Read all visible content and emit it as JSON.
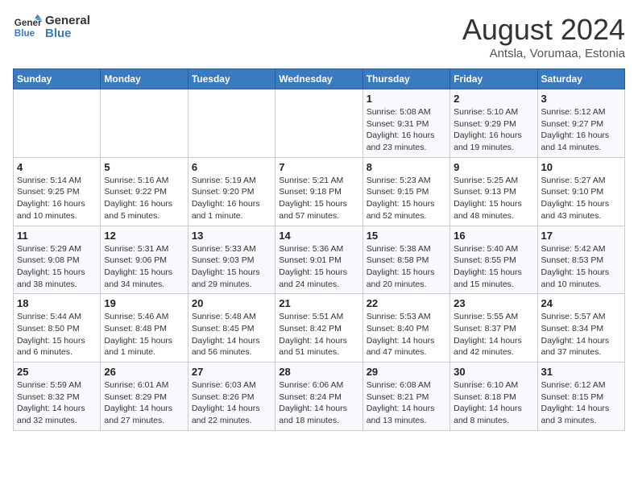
{
  "header": {
    "logo_line1": "General",
    "logo_line2": "Blue",
    "month": "August 2024",
    "location": "Antsla, Vorumaa, Estonia"
  },
  "weekdays": [
    "Sunday",
    "Monday",
    "Tuesday",
    "Wednesday",
    "Thursday",
    "Friday",
    "Saturday"
  ],
  "weeks": [
    [
      {
        "day": "",
        "info": ""
      },
      {
        "day": "",
        "info": ""
      },
      {
        "day": "",
        "info": ""
      },
      {
        "day": "",
        "info": ""
      },
      {
        "day": "1",
        "info": "Sunrise: 5:08 AM\nSunset: 9:31 PM\nDaylight: 16 hours and 23 minutes."
      },
      {
        "day": "2",
        "info": "Sunrise: 5:10 AM\nSunset: 9:29 PM\nDaylight: 16 hours and 19 minutes."
      },
      {
        "day": "3",
        "info": "Sunrise: 5:12 AM\nSunset: 9:27 PM\nDaylight: 16 hours and 14 minutes."
      }
    ],
    [
      {
        "day": "4",
        "info": "Sunrise: 5:14 AM\nSunset: 9:25 PM\nDaylight: 16 hours and 10 minutes."
      },
      {
        "day": "5",
        "info": "Sunrise: 5:16 AM\nSunset: 9:22 PM\nDaylight: 16 hours and 5 minutes."
      },
      {
        "day": "6",
        "info": "Sunrise: 5:19 AM\nSunset: 9:20 PM\nDaylight: 16 hours and 1 minute."
      },
      {
        "day": "7",
        "info": "Sunrise: 5:21 AM\nSunset: 9:18 PM\nDaylight: 15 hours and 57 minutes."
      },
      {
        "day": "8",
        "info": "Sunrise: 5:23 AM\nSunset: 9:15 PM\nDaylight: 15 hours and 52 minutes."
      },
      {
        "day": "9",
        "info": "Sunrise: 5:25 AM\nSunset: 9:13 PM\nDaylight: 15 hours and 48 minutes."
      },
      {
        "day": "10",
        "info": "Sunrise: 5:27 AM\nSunset: 9:10 PM\nDaylight: 15 hours and 43 minutes."
      }
    ],
    [
      {
        "day": "11",
        "info": "Sunrise: 5:29 AM\nSunset: 9:08 PM\nDaylight: 15 hours and 38 minutes."
      },
      {
        "day": "12",
        "info": "Sunrise: 5:31 AM\nSunset: 9:06 PM\nDaylight: 15 hours and 34 minutes."
      },
      {
        "day": "13",
        "info": "Sunrise: 5:33 AM\nSunset: 9:03 PM\nDaylight: 15 hours and 29 minutes."
      },
      {
        "day": "14",
        "info": "Sunrise: 5:36 AM\nSunset: 9:01 PM\nDaylight: 15 hours and 24 minutes."
      },
      {
        "day": "15",
        "info": "Sunrise: 5:38 AM\nSunset: 8:58 PM\nDaylight: 15 hours and 20 minutes."
      },
      {
        "day": "16",
        "info": "Sunrise: 5:40 AM\nSunset: 8:55 PM\nDaylight: 15 hours and 15 minutes."
      },
      {
        "day": "17",
        "info": "Sunrise: 5:42 AM\nSunset: 8:53 PM\nDaylight: 15 hours and 10 minutes."
      }
    ],
    [
      {
        "day": "18",
        "info": "Sunrise: 5:44 AM\nSunset: 8:50 PM\nDaylight: 15 hours and 6 minutes."
      },
      {
        "day": "19",
        "info": "Sunrise: 5:46 AM\nSunset: 8:48 PM\nDaylight: 15 hours and 1 minute."
      },
      {
        "day": "20",
        "info": "Sunrise: 5:48 AM\nSunset: 8:45 PM\nDaylight: 14 hours and 56 minutes."
      },
      {
        "day": "21",
        "info": "Sunrise: 5:51 AM\nSunset: 8:42 PM\nDaylight: 14 hours and 51 minutes."
      },
      {
        "day": "22",
        "info": "Sunrise: 5:53 AM\nSunset: 8:40 PM\nDaylight: 14 hours and 47 minutes."
      },
      {
        "day": "23",
        "info": "Sunrise: 5:55 AM\nSunset: 8:37 PM\nDaylight: 14 hours and 42 minutes."
      },
      {
        "day": "24",
        "info": "Sunrise: 5:57 AM\nSunset: 8:34 PM\nDaylight: 14 hours and 37 minutes."
      }
    ],
    [
      {
        "day": "25",
        "info": "Sunrise: 5:59 AM\nSunset: 8:32 PM\nDaylight: 14 hours and 32 minutes."
      },
      {
        "day": "26",
        "info": "Sunrise: 6:01 AM\nSunset: 8:29 PM\nDaylight: 14 hours and 27 minutes."
      },
      {
        "day": "27",
        "info": "Sunrise: 6:03 AM\nSunset: 8:26 PM\nDaylight: 14 hours and 22 minutes."
      },
      {
        "day": "28",
        "info": "Sunrise: 6:06 AM\nSunset: 8:24 PM\nDaylight: 14 hours and 18 minutes."
      },
      {
        "day": "29",
        "info": "Sunrise: 6:08 AM\nSunset: 8:21 PM\nDaylight: 14 hours and 13 minutes."
      },
      {
        "day": "30",
        "info": "Sunrise: 6:10 AM\nSunset: 8:18 PM\nDaylight: 14 hours and 8 minutes."
      },
      {
        "day": "31",
        "info": "Sunrise: 6:12 AM\nSunset: 8:15 PM\nDaylight: 14 hours and 3 minutes."
      }
    ]
  ]
}
